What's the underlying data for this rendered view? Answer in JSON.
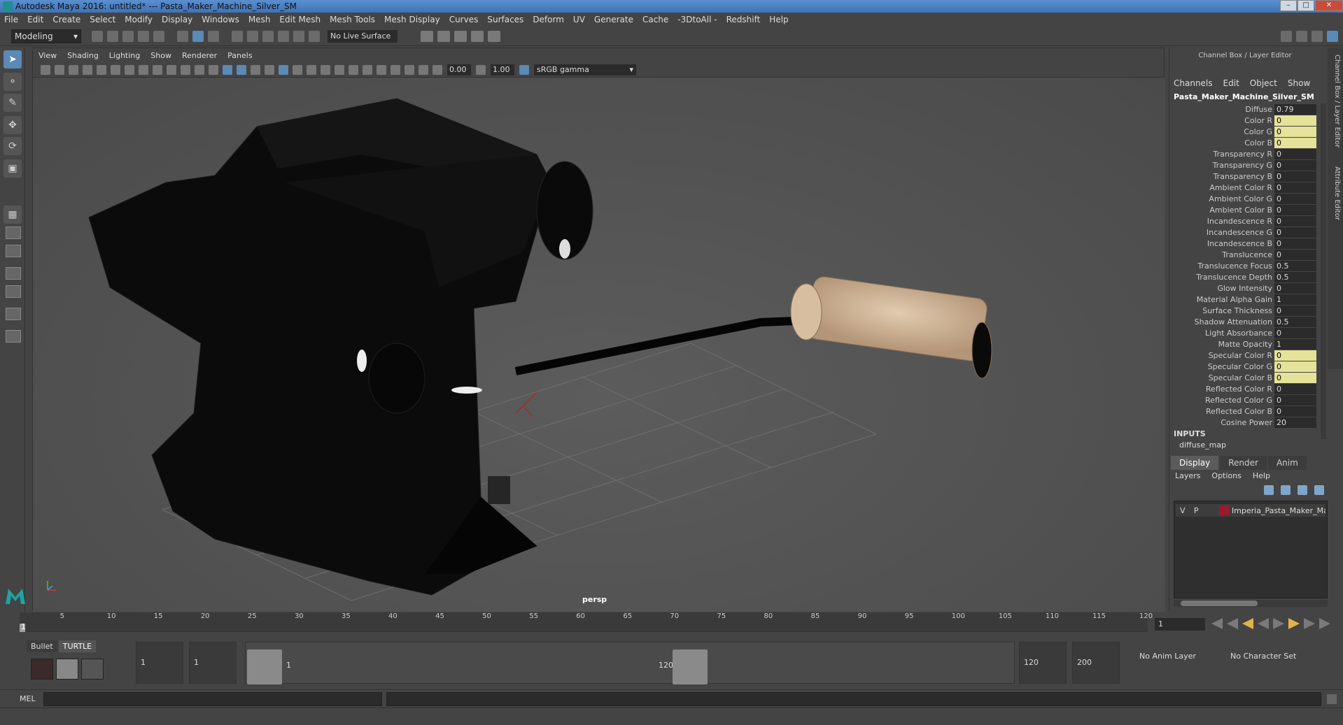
{
  "window": {
    "title": "Autodesk Maya 2016: untitled*    ---    Pasta_Maker_Machine_Silver_SM"
  },
  "menubar": [
    "File",
    "Edit",
    "Create",
    "Select",
    "Modify",
    "Display",
    "Windows",
    "Mesh",
    "Edit Mesh",
    "Mesh Tools",
    "Mesh Display",
    "Curves",
    "Surfaces",
    "Deform",
    "UV",
    "Generate",
    "Cache",
    "-3DtoAll -",
    "Redshift",
    "Help"
  ],
  "statusline": {
    "mode": "Modeling",
    "live_surface": "No Live Surface"
  },
  "viewport": {
    "menu": [
      "View",
      "Shading",
      "Lighting",
      "Show",
      "Renderer",
      "Panels"
    ],
    "exposure": "0.00",
    "gamma": "1.00",
    "colorspace": "sRGB gamma",
    "camera": "persp"
  },
  "channelbox": {
    "title": "Channel Box / Layer Editor",
    "menu": [
      "Channels",
      "Edit",
      "Object",
      "Show"
    ],
    "object_name": "Pasta_Maker_Machine_Silver_SM",
    "attributes": [
      {
        "label": "Diffuse",
        "value": "0.79",
        "hl": false
      },
      {
        "label": "Color R",
        "value": "0",
        "hl": true
      },
      {
        "label": "Color G",
        "value": "0",
        "hl": true
      },
      {
        "label": "Color B",
        "value": "0",
        "hl": true
      },
      {
        "label": "Transparency R",
        "value": "0",
        "hl": false
      },
      {
        "label": "Transparency G",
        "value": "0",
        "hl": false
      },
      {
        "label": "Transparency B",
        "value": "0",
        "hl": false
      },
      {
        "label": "Ambient Color R",
        "value": "0",
        "hl": false
      },
      {
        "label": "Ambient Color G",
        "value": "0",
        "hl": false
      },
      {
        "label": "Ambient Color B",
        "value": "0",
        "hl": false
      },
      {
        "label": "Incandescence R",
        "value": "0",
        "hl": false
      },
      {
        "label": "Incandescence G",
        "value": "0",
        "hl": false
      },
      {
        "label": "Incandescence B",
        "value": "0",
        "hl": false
      },
      {
        "label": "Translucence",
        "value": "0",
        "hl": false
      },
      {
        "label": "Translucence Focus",
        "value": "0.5",
        "hl": false
      },
      {
        "label": "Translucence Depth",
        "value": "0.5",
        "hl": false
      },
      {
        "label": "Glow Intensity",
        "value": "0",
        "hl": false
      },
      {
        "label": "Material Alpha Gain",
        "value": "1",
        "hl": false
      },
      {
        "label": "Surface Thickness",
        "value": "0",
        "hl": false
      },
      {
        "label": "Shadow Attenuation",
        "value": "0.5",
        "hl": false
      },
      {
        "label": "Light Absorbance",
        "value": "0",
        "hl": false
      },
      {
        "label": "Matte Opacity",
        "value": "1",
        "hl": false
      },
      {
        "label": "Specular Color R",
        "value": "0",
        "hl": true
      },
      {
        "label": "Specular Color G",
        "value": "0",
        "hl": true
      },
      {
        "label": "Specular Color B",
        "value": "0",
        "hl": true
      },
      {
        "label": "Reflected Color R",
        "value": "0",
        "hl": false
      },
      {
        "label": "Reflected Color G",
        "value": "0",
        "hl": false
      },
      {
        "label": "Reflected Color B",
        "value": "0",
        "hl": false
      },
      {
        "label": "Cosine Power",
        "value": "20",
        "hl": false
      }
    ],
    "inputs_label": "INPUTS",
    "input_item": "diffuse_map",
    "side_tabs": [
      "Channel Box / Layer Editor",
      "Attribute Editor"
    ]
  },
  "layer_editor": {
    "tabs": [
      "Display",
      "Render",
      "Anim"
    ],
    "menu": [
      "Layers",
      "Options",
      "Help"
    ],
    "layer": {
      "v": "V",
      "p": "P",
      "name": "Imperia_Pasta_Maker_Ma"
    }
  },
  "timeslider": {
    "ticks": [
      "5",
      "10",
      "15",
      "20",
      "25",
      "30",
      "35",
      "40",
      "45",
      "50",
      "55",
      "60",
      "65",
      "70",
      "75",
      "80",
      "85",
      "90",
      "95",
      "100",
      "105",
      "110",
      "115",
      "120"
    ],
    "current": "1",
    "current_field": "1"
  },
  "rangebar": {
    "shelf_tabs": [
      "Bullet",
      "TURTLE"
    ],
    "start": "1",
    "anim_start": "1",
    "range_start": "1",
    "range_end": "120",
    "anim_end": "120",
    "end": "200",
    "anim_layer": "No Anim Layer",
    "char_set": "No Character Set"
  },
  "cmdline": {
    "label": "MEL"
  },
  "colors": {
    "accent": "#5a8ab5",
    "highlight": "#e5e29a",
    "layer_color": "#9a1a2b"
  }
}
